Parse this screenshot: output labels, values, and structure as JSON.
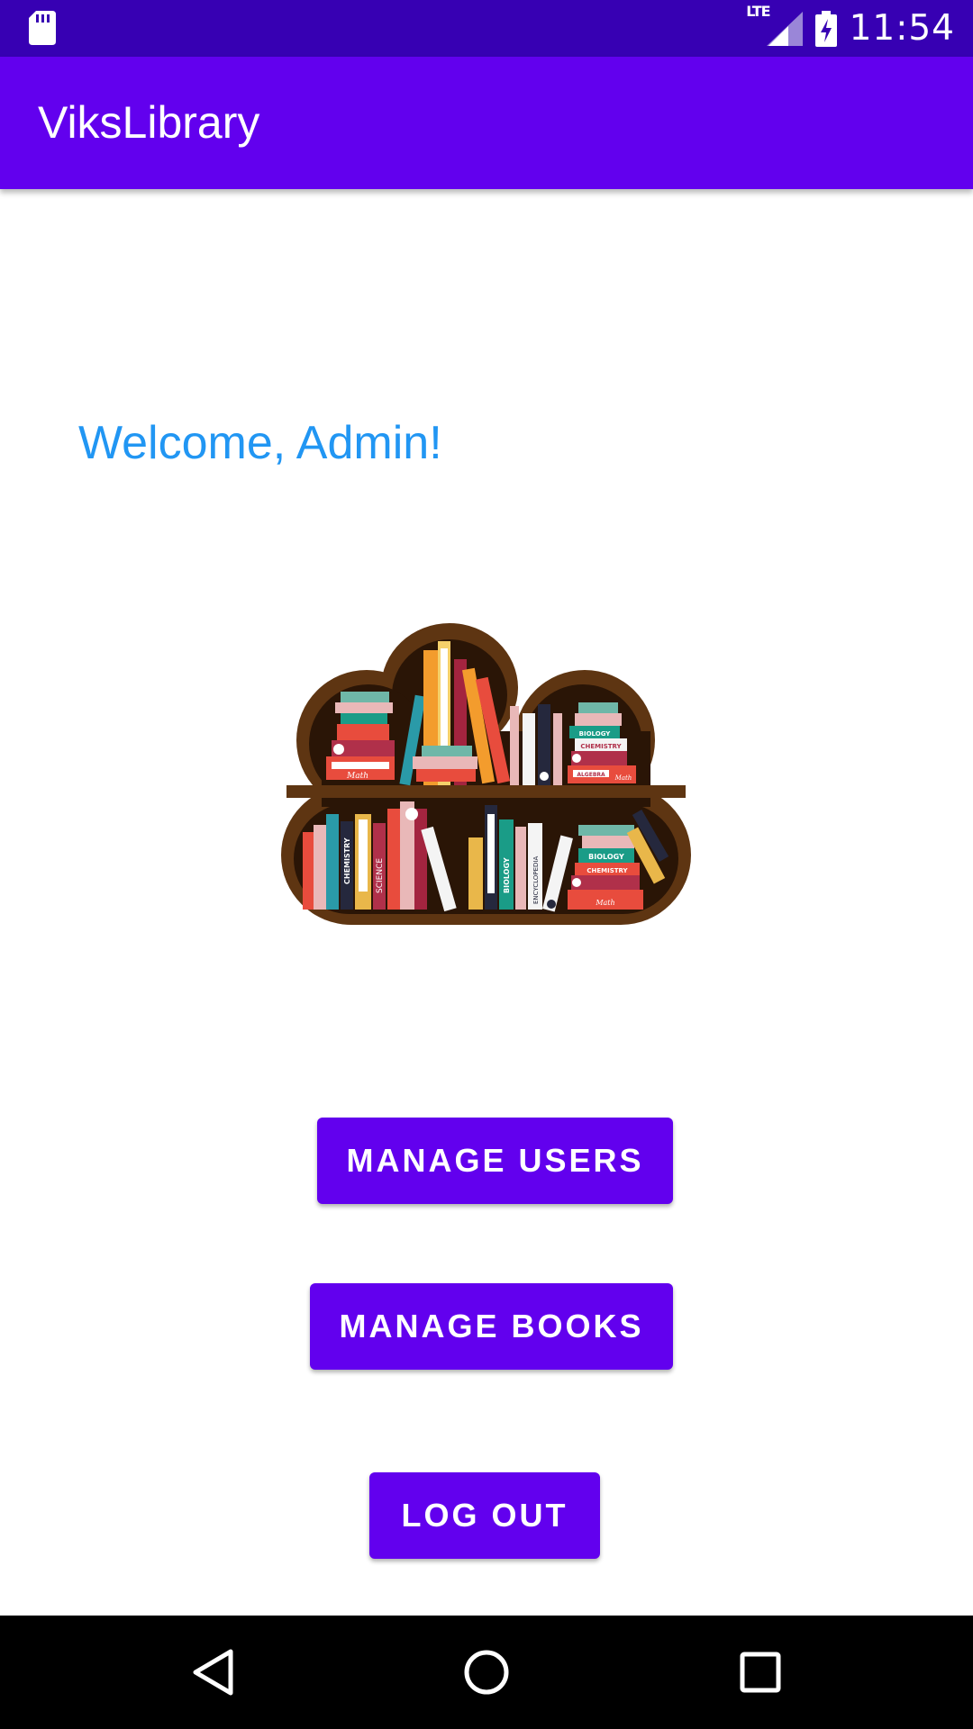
{
  "status_bar": {
    "network": "LTE",
    "time": "11:54"
  },
  "app_bar": {
    "title": "ViksLibrary"
  },
  "main": {
    "welcome_text": "Welcome, Admin!",
    "illustration": {
      "icon": "bookshelf-cloud-illustration",
      "book_labels": [
        "Math",
        "BIOLOGY",
        "CHEMISTRY",
        "ALGEBRA",
        "Math",
        "CHEMISTRY",
        "SCIENCE",
        "BIOLOGY",
        "ENCYCLOPEDIA",
        "BIOLOGY",
        "CHEMISTRY",
        "Math"
      ]
    },
    "buttons": {
      "manage_users": "MANAGE USERS",
      "manage_books": "MANAGE BOOKS",
      "log_out": "LOG OUT"
    }
  },
  "nav_bar": {
    "icons": [
      "back-icon",
      "home-icon",
      "recents-icon"
    ]
  },
  "colors": {
    "status_bar": "#3700b3",
    "primary": "#6200ee",
    "welcome_text": "#2196f3",
    "shelf_frame": "#5e3512",
    "shelf_inside": "#2a1506"
  }
}
